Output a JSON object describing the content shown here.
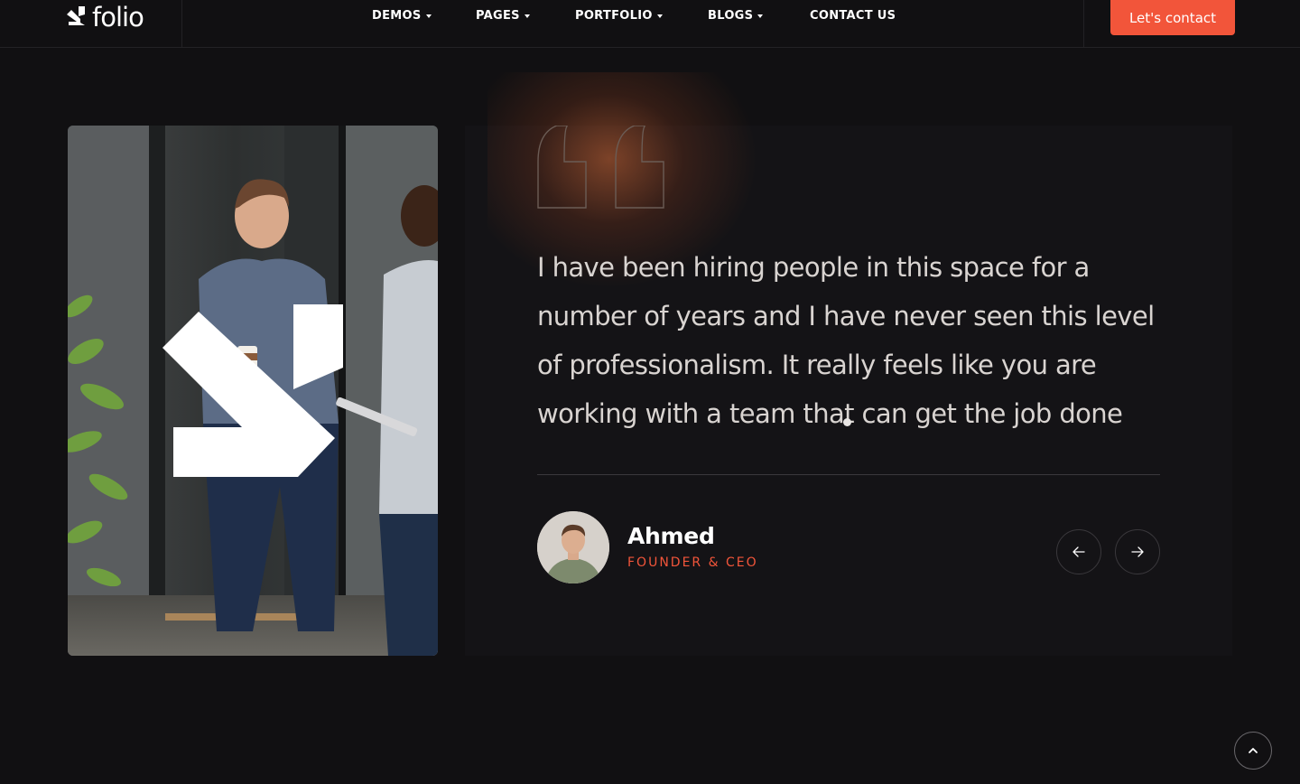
{
  "brand": {
    "name": "folio",
    "accent": "#f2553a"
  },
  "nav": {
    "items": [
      {
        "label": "DEMOS",
        "has_dropdown": true
      },
      {
        "label": "PAGES",
        "has_dropdown": true
      },
      {
        "label": "PORTFOLIO",
        "has_dropdown": true
      },
      {
        "label": "BLOGS",
        "has_dropdown": true
      },
      {
        "label": "CONTACT US",
        "has_dropdown": false
      }
    ],
    "cta_label": "Let's contact"
  },
  "testimonial": {
    "quote": "I have been hiring people in this space for a number of years and I have never seen this level of professionalism. It really feels like you are working with a team that can get the job done",
    "author_name": "Ahmed",
    "author_role": "FOUNDER & CEO",
    "prev_icon": "arrow-left-icon",
    "next_icon": "arrow-right-icon"
  },
  "scroll_top_icon": "chevron-up-icon"
}
